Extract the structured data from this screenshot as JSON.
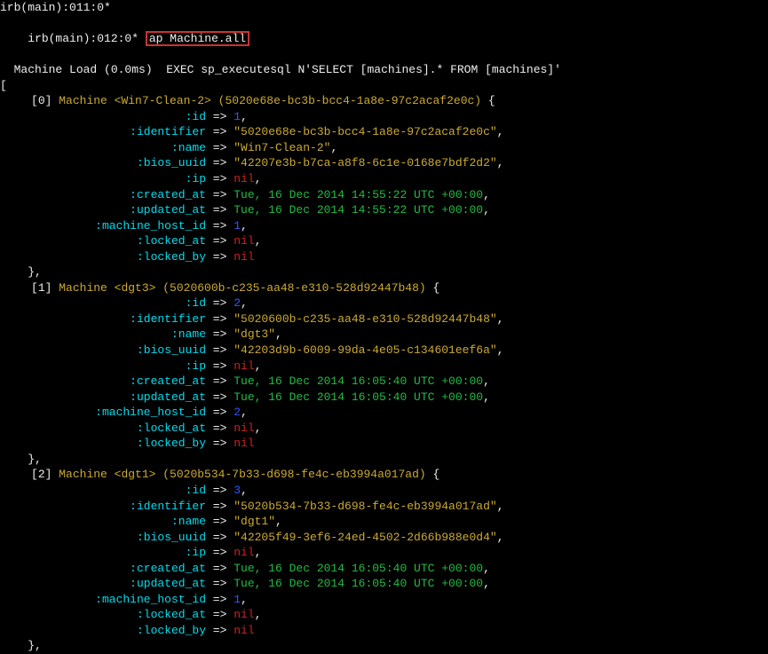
{
  "prompt_prev": "irb(main):011:0*",
  "prompt": "irb(main):012:0*",
  "command_prefix": "ap ",
  "command": "Machine.all",
  "sql_load": "  Machine Load (0.0ms)  EXEC sp_executesql N'SELECT [machines].* FROM [machines]'",
  "open_bracket": "[",
  "entries": [
    {
      "idx": "0",
      "klass": "Machine",
      "hostname": "Win7-Clean-2",
      "uuid_paren": "5020e68e-bc3b-bcc4-1a8e-97c2acaf2e0c",
      "kv": [
        {
          "k": ":id",
          "v": "1",
          "vt": "int"
        },
        {
          "k": ":identifier",
          "v": "\"5020e68e-bc3b-bcc4-1a8e-97c2acaf2e0c\"",
          "vt": "str"
        },
        {
          "k": ":name",
          "v": "\"Win7-Clean-2\"",
          "vt": "str"
        },
        {
          "k": ":bios_uuid",
          "v": "\"42207e3b-b7ca-a8f8-6c1e-0168e7bdf2d2\"",
          "vt": "str"
        },
        {
          "k": ":ip",
          "v": "nil",
          "vt": "nil"
        },
        {
          "k": ":created_at",
          "v": "Tue, 16 Dec 2014 14:55:22 UTC +00:00",
          "vt": "date"
        },
        {
          "k": ":updated_at",
          "v": "Tue, 16 Dec 2014 14:55:22 UTC +00:00",
          "vt": "date"
        },
        {
          "k": ":machine_host_id",
          "v": "1",
          "vt": "int"
        },
        {
          "k": ":locked_at",
          "v": "nil",
          "vt": "nil"
        },
        {
          "k": ":locked_by",
          "v": "nil",
          "vt": "nil"
        }
      ]
    },
    {
      "idx": "1",
      "klass": "Machine",
      "hostname": "dgt3",
      "uuid_paren": "5020600b-c235-aa48-e310-528d92447b48",
      "kv": [
        {
          "k": ":id",
          "v": "2",
          "vt": "int"
        },
        {
          "k": ":identifier",
          "v": "\"5020600b-c235-aa48-e310-528d92447b48\"",
          "vt": "str"
        },
        {
          "k": ":name",
          "v": "\"dgt3\"",
          "vt": "str"
        },
        {
          "k": ":bios_uuid",
          "v": "\"42203d9b-6009-99da-4e05-c134601eef6a\"",
          "vt": "str"
        },
        {
          "k": ":ip",
          "v": "nil",
          "vt": "nil"
        },
        {
          "k": ":created_at",
          "v": "Tue, 16 Dec 2014 16:05:40 UTC +00:00",
          "vt": "date"
        },
        {
          "k": ":updated_at",
          "v": "Tue, 16 Dec 2014 16:05:40 UTC +00:00",
          "vt": "date"
        },
        {
          "k": ":machine_host_id",
          "v": "2",
          "vt": "int"
        },
        {
          "k": ":locked_at",
          "v": "nil",
          "vt": "nil"
        },
        {
          "k": ":locked_by",
          "v": "nil",
          "vt": "nil"
        }
      ]
    },
    {
      "idx": "2",
      "klass": "Machine",
      "hostname": "dgt1",
      "uuid_paren": "5020b534-7b33-d698-fe4c-eb3994a017ad",
      "kv": [
        {
          "k": ":id",
          "v": "3",
          "vt": "int"
        },
        {
          "k": ":identifier",
          "v": "\"5020b534-7b33-d698-fe4c-eb3994a017ad\"",
          "vt": "str"
        },
        {
          "k": ":name",
          "v": "\"dgt1\"",
          "vt": "str"
        },
        {
          "k": ":bios_uuid",
          "v": "\"42205f49-3ef6-24ed-4502-2d66b988e0d4\"",
          "vt": "str"
        },
        {
          "k": ":ip",
          "v": "nil",
          "vt": "nil"
        },
        {
          "k": ":created_at",
          "v": "Tue, 16 Dec 2014 16:05:40 UTC +00:00",
          "vt": "date"
        },
        {
          "k": ":updated_at",
          "v": "Tue, 16 Dec 2014 16:05:40 UTC +00:00",
          "vt": "date"
        },
        {
          "k": ":machine_host_id",
          "v": "1",
          "vt": "int"
        },
        {
          "k": ":locked_at",
          "v": "nil",
          "vt": "nil"
        },
        {
          "k": ":locked_by",
          "v": "nil",
          "vt": "nil"
        }
      ]
    }
  ],
  "close_brace": "    },"
}
